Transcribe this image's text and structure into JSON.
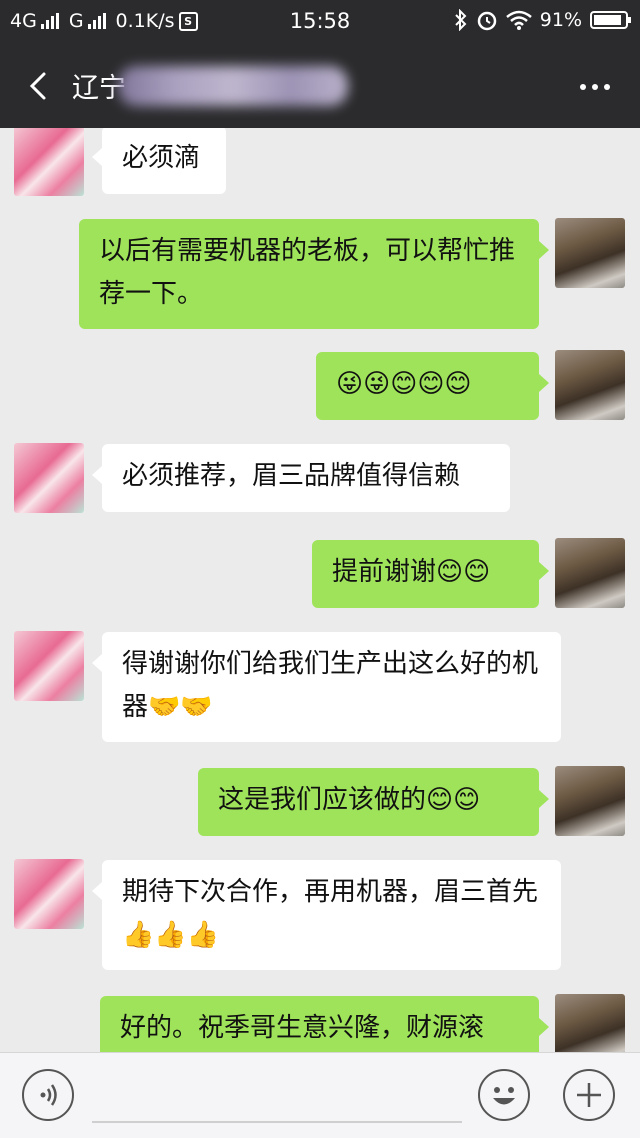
{
  "status_bar": {
    "network1": "4G",
    "network2": "G",
    "speed": "0.1K/s",
    "s_badge": "S",
    "time": "15:58",
    "battery_percent": "91%",
    "battery_level": 0.91,
    "icons": [
      "signal-icon",
      "bluetooth-icon",
      "alarm-icon",
      "wifi-icon",
      "battery-icon"
    ]
  },
  "header": {
    "title_visible": "辽宁",
    "back_icon": "chevron-left-icon",
    "more_icon": "more-dots-icon"
  },
  "messages": [
    {
      "side": "left",
      "text": "必须滴"
    },
    {
      "side": "right",
      "text": "以后有需要机器的老板，可以帮忙推荐一下。"
    },
    {
      "side": "right",
      "text": "😜😜😊😊😊"
    },
    {
      "side": "left",
      "text": "必须推荐，眉三品牌值得信赖"
    },
    {
      "side": "right",
      "text": "提前谢谢😊😊"
    },
    {
      "side": "left",
      "text": "得谢谢你们给我们生产出这么好的机器🤝🤝"
    },
    {
      "side": "right",
      "text": "这是我们应该做的😊😊"
    },
    {
      "side": "left",
      "text": "期待下次合作，再用机器，眉三首先👍👍👍"
    },
    {
      "side": "right",
      "text": "好的。祝季哥生意兴隆，财源滚"
    }
  ],
  "input_bar": {
    "voice_icon": "voice-icon",
    "emoji_icon": "emoji-icon",
    "plus_icon": "plus-icon"
  },
  "colors": {
    "header_bg": "#2b2b2d",
    "chat_bg": "#ebebeb",
    "bubble_green": "#9fe35a",
    "bubble_white": "#ffffff"
  }
}
